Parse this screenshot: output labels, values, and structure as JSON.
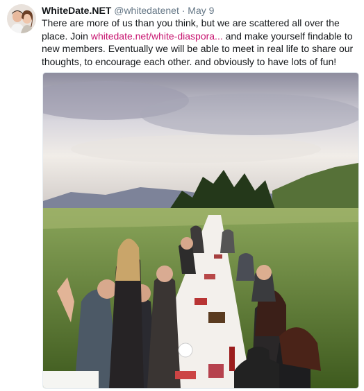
{
  "tweet": {
    "display_name": "WhiteDate.NET",
    "handle": "@whitedatenet",
    "separator": "·",
    "date": "May 9",
    "text_before_link": "There are more of us than you think, but we are scattered all over the place. Join ",
    "link_text": "whitedate.net/white-diaspora...",
    "text_after_link": " and make yourself findable to new members. Eventually we will be able to meet in real life to share our thoughts, to encourage each other. and obviously to have lots of fun!"
  },
  "colors": {
    "name": "#14171a",
    "secondary": "#657786",
    "link": "#c7136f"
  },
  "icons": {
    "avatar": "profile-photo",
    "media": "outdoor-long-table-dinner-photo"
  }
}
